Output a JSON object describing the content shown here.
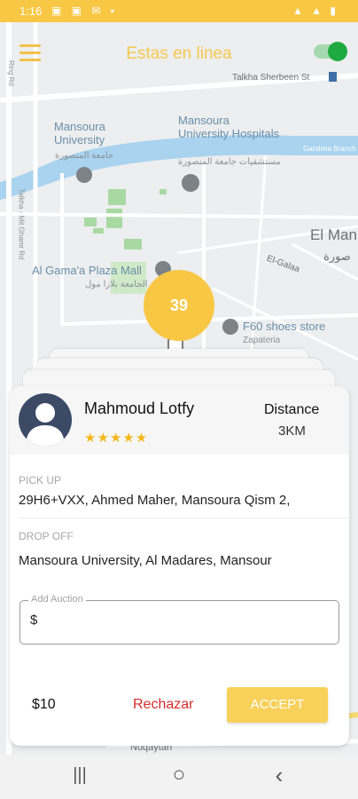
{
  "status_bar": {
    "time": "1:16",
    "left_icons": "▣ ▣ ✉ ▪",
    "right_icons": "▲ ▲ ▮"
  },
  "header": {
    "title": "Estas en linea",
    "menu_icon": "hamburger-icon",
    "online": true
  },
  "map": {
    "labels": {
      "talkha_sherbeen": "Talkha Sherbeen St",
      "mansoura_university": "Mansoura\nUniversity",
      "mansoura_university_ar": "جامعة المنصورة",
      "hospitals": "Mansoura\nUniversity Hospitals",
      "hospitals_ar": "مستشفيات جامعة المنصورة",
      "el_man": "El Man",
      "el_man_ar": "صورة",
      "gamaa_plaza": "Al Gama'a Plaza Mall",
      "gamaa_plaza_ar": "الجامعة بلازا مول",
      "el_galaa": "El-Galaa",
      "f60": "F60 shoes store",
      "zapateria": "Zapateria",
      "gandelia": "Gandelia Branch",
      "nuqaytah": "Nuqaytah",
      "meet_ghamr_rd": "Talkha - Mit Ghamr Rd",
      "ring_rd": "Ring Rd"
    },
    "counter": "39"
  },
  "request": {
    "rider_name": "Mahmoud Lotfy",
    "rating_stars": "★★★★★",
    "distance_label": "Distance",
    "distance_value": "3KM",
    "pickup_label": "PICK UP",
    "pickup_value": "29H6+VXX, Ahmed Maher, Mansoura Qism 2,",
    "dropoff_label": "DROP OFF",
    "dropoff_value": "Mansoura University, Al Madares, Mansour",
    "auction_label": "Add Auction",
    "auction_value": "$",
    "price": "$10",
    "reject_label": "Rechazar",
    "accept_label": "ACCEPT"
  },
  "nav_bar": {
    "recents": "|||",
    "home": "○",
    "back": "‹"
  },
  "colors": {
    "accent": "#f8c845",
    "reject": "#d62c2c",
    "online_green": "#1faa3f"
  }
}
